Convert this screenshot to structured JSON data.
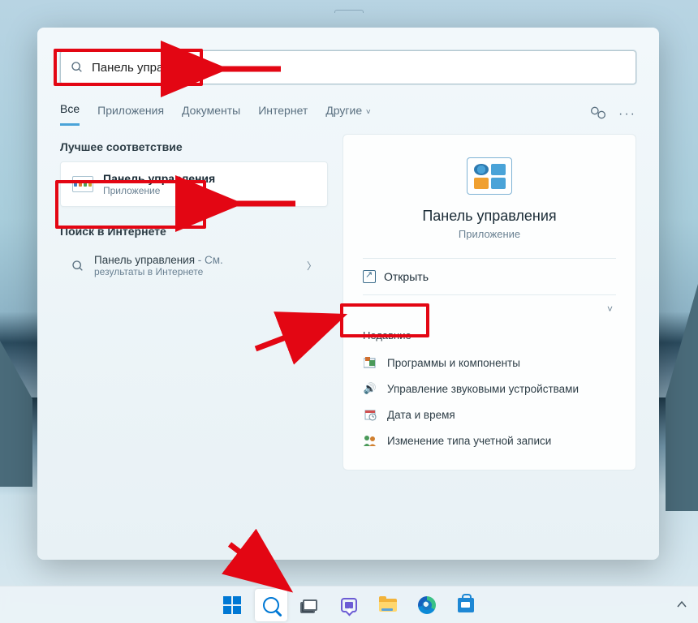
{
  "search": {
    "value": "Панель управления"
  },
  "tabs": {
    "all": "Все",
    "apps": "Приложения",
    "docs": "Документы",
    "web": "Интернет",
    "more": "Другие"
  },
  "left": {
    "best_match_header": "Лучшее соответствие",
    "best_match": {
      "title": "Панель управления",
      "subtitle": "Приложение"
    },
    "web_header": "Поиск в Интернете",
    "web_item_prefix": "Панель управления",
    "web_item_suffix": " - См.",
    "web_item_sub": "результаты в Интернете"
  },
  "right": {
    "title": "Панель управления",
    "subtitle": "Приложение",
    "open": "Открыть",
    "recent_header": "Недавние",
    "recent": [
      "Программы и компоненты",
      "Управление звуковыми устройствами",
      "Дата и время",
      "Изменение типа учетной записи"
    ]
  }
}
